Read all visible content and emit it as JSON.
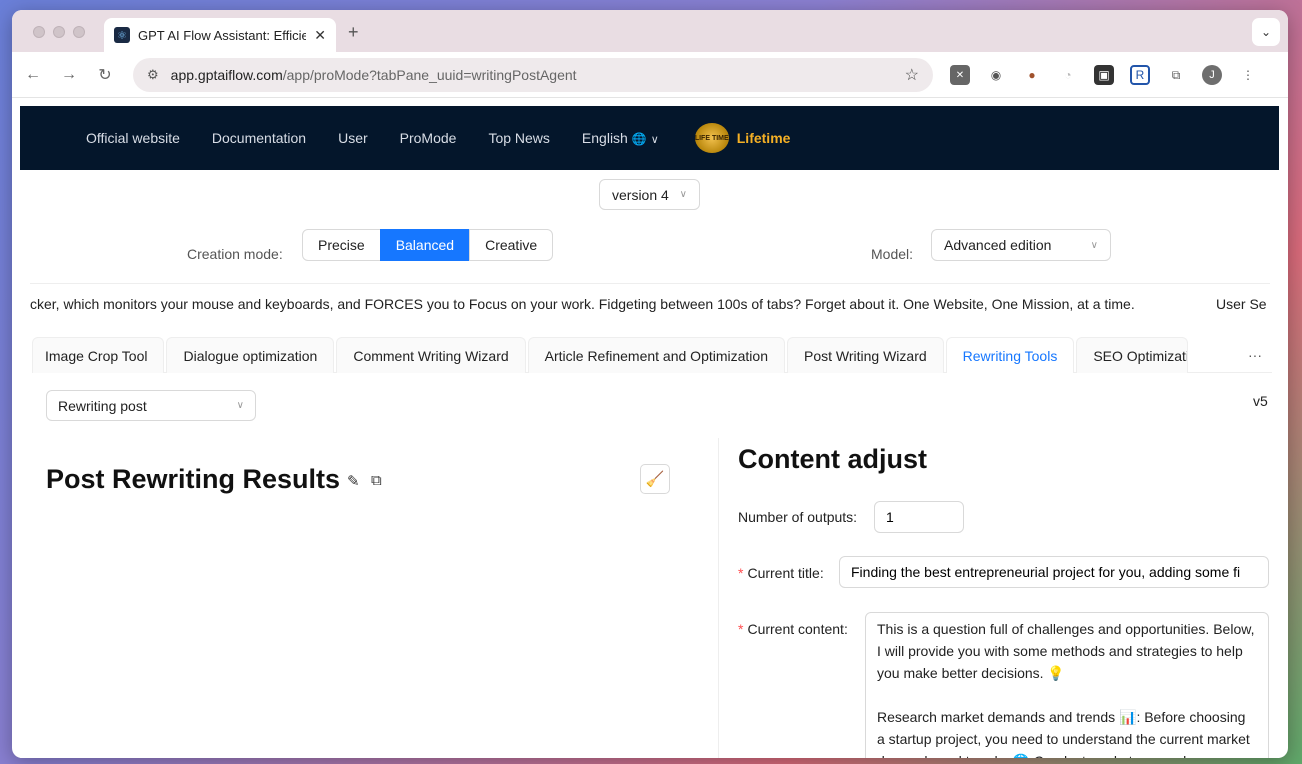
{
  "browser": {
    "tab_title": "GPT AI Flow Assistant: Efficie",
    "url_host": "app.gptaiflow.com",
    "url_path": "/app/proMode?tabPane_uuid=writingPostAgent",
    "avatar_initial": "J"
  },
  "nav": {
    "items": [
      "Official website",
      "Documentation",
      "User",
      "ProMode",
      "Top News"
    ],
    "language": "English",
    "lifetime_badge": "LIFE TIME",
    "lifetime": "Lifetime"
  },
  "version": {
    "selected": "version 4"
  },
  "creation_mode": {
    "label": "Creation mode:",
    "options": [
      "Precise",
      "Balanced",
      "Creative"
    ],
    "active": "Balanced"
  },
  "model": {
    "label": "Model:",
    "selected": "Advanced edition"
  },
  "ticker": {
    "text": "cker, which monitors your mouse and keyboards, and FORCES you to Focus on your work. Fidgeting between 100s of tabs? Forget about it. One Website, One Mission, at a time.",
    "next": "User Se"
  },
  "tools_tabs": [
    "Image Crop Tool",
    "Dialogue optimization",
    "Comment Writing Wizard",
    "Article Refinement and Optimization",
    "Post Writing Wizard",
    "Rewriting Tools",
    "SEO Optimizati"
  ],
  "tools_more": "···",
  "rewrite": {
    "selected": "Rewriting post",
    "version": "v5"
  },
  "results": {
    "title": "Post Rewriting Results"
  },
  "adjust": {
    "title": "Content adjust",
    "outputs_label": "Number of outputs",
    "outputs_value": "1",
    "title_label": "Current title",
    "title_value": "Finding the best entrepreneurial project for you, adding some fi",
    "content_label": "Current content",
    "content_value": "This is a question full of challenges and opportunities. Below, I will provide you with some methods and strategies to help you make better decisions. 💡\n\nResearch market demands and trends 📊: Before choosing a startup project, you need to understand the current market demands and trends. 🌐 Conduct market research,"
  }
}
